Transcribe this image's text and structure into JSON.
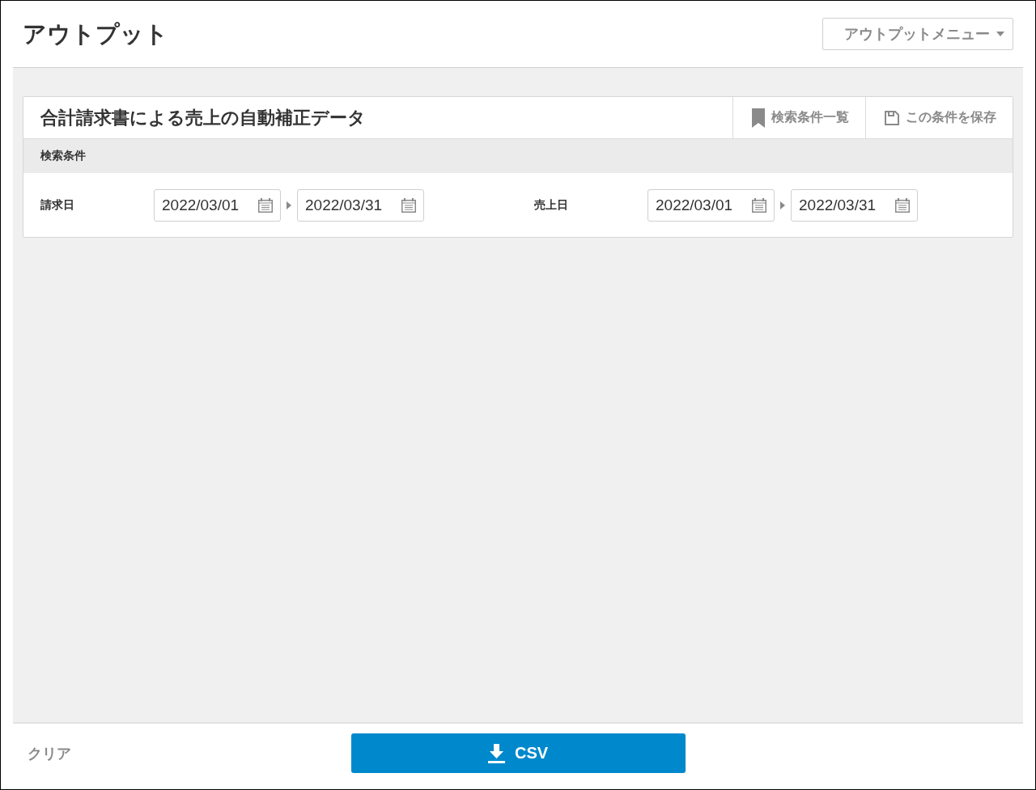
{
  "header": {
    "title": "アウトプット",
    "menu_button": "アウトプットメニュー"
  },
  "panel": {
    "title": "合計請求書による売上の自動補正データ",
    "actions": [
      {
        "kind": "bookmark",
        "label": "検索条件一覧"
      },
      {
        "kind": "save",
        "label": "この条件を保存"
      }
    ],
    "section_title": "検索条件",
    "filters": [
      {
        "label": "請求日",
        "from": "2022/03/01",
        "to": "2022/03/31"
      },
      {
        "label": "売上日",
        "from": "2022/03/01",
        "to": "2022/03/31"
      }
    ]
  },
  "footer": {
    "clear": "クリア",
    "download": "CSV"
  }
}
